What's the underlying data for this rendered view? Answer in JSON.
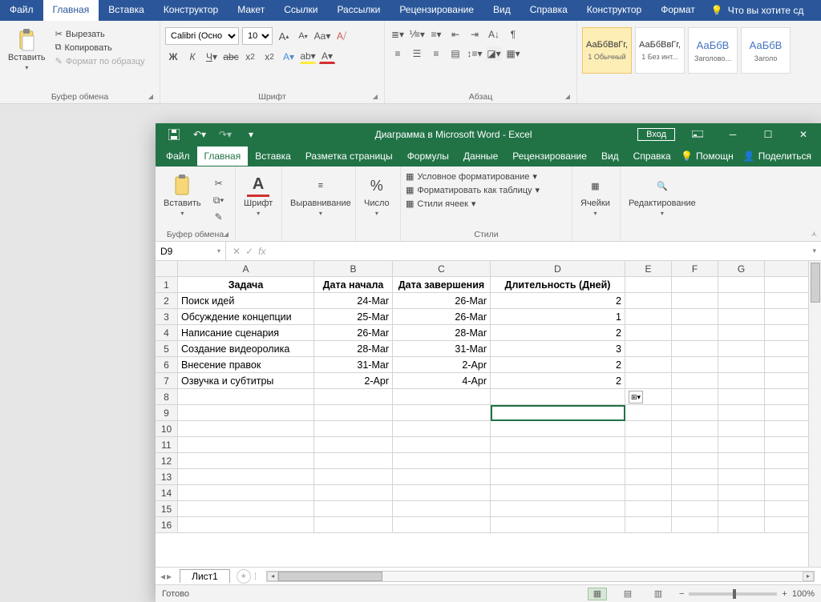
{
  "word": {
    "tabs": [
      "Файл",
      "Главная",
      "Вставка",
      "Конструктор",
      "Макет",
      "Ссылки",
      "Рассылки",
      "Рецензирование",
      "Вид",
      "Справка",
      "Конструктор",
      "Формат"
    ],
    "activeTab": 1,
    "tellMe": "Что вы хотите сд",
    "clipboard": {
      "paste": "Вставить",
      "cut": "Вырезать",
      "copy": "Копировать",
      "format": "Формат по образцу",
      "groupLabel": "Буфер обмена"
    },
    "font": {
      "name": "Calibri (Осно",
      "size": "10",
      "groupLabel": "Шрифт"
    },
    "paragraph": {
      "groupLabel": "Абзац"
    },
    "styles": [
      {
        "preview": "АаБбВвГг,",
        "label": "1 Обычный",
        "sel": true,
        "blue": false
      },
      {
        "preview": "АаБбВвГг,",
        "label": "1 Без инт...",
        "sel": false,
        "blue": false
      },
      {
        "preview": "АаБбВ",
        "label": "Заголово...",
        "sel": false,
        "blue": true
      },
      {
        "preview": "АаБбВ",
        "label": "Заголо",
        "sel": false,
        "blue": true
      }
    ]
  },
  "excel": {
    "title": "Диаграмма в Microsoft Word  -  Excel",
    "login": "Вход",
    "tabs": [
      "Файл",
      "Главная",
      "Вставка",
      "Разметка страницы",
      "Формулы",
      "Данные",
      "Рецензирование",
      "Вид",
      "Справка"
    ],
    "activeTab": 1,
    "help": "Помощн",
    "share": "Поделиться",
    "ribbon": {
      "clipboard": {
        "paste": "Вставить",
        "group": "Буфер обмена"
      },
      "font": {
        "label": "Шрифт"
      },
      "align": {
        "label": "Выравнивание"
      },
      "number": {
        "label": "Число",
        "pct": "%"
      },
      "styles": {
        "cond": "Условное форматирование",
        "table": "Форматировать как таблицу",
        "cell": "Стили ячеек",
        "group": "Стили"
      },
      "cells": {
        "label": "Ячейки"
      },
      "edit": {
        "label": "Редактирование"
      }
    },
    "namebox": "D9",
    "columns": [
      "A",
      "B",
      "C",
      "D",
      "E",
      "F",
      "G"
    ],
    "headerRow": [
      "Задача",
      "Дата начала",
      "Дата завершения",
      "Длительность (Дней)",
      "",
      "",
      ""
    ],
    "rows": [
      [
        "Поиск идей",
        "24-Mar",
        "26-Mar",
        "2",
        "",
        "",
        ""
      ],
      [
        "Обсуждение концепции",
        "25-Mar",
        "26-Mar",
        "1",
        "",
        "",
        ""
      ],
      [
        "Написание сценария",
        "26-Mar",
        "28-Mar",
        "2",
        "",
        "",
        ""
      ],
      [
        "Создание видеоролика",
        "28-Mar",
        "31-Mar",
        "3",
        "",
        "",
        ""
      ],
      [
        "Внесение правок",
        "31-Mar",
        "2-Apr",
        "2",
        "",
        "",
        ""
      ],
      [
        "Озвучка и субтитры",
        "2-Apr",
        "4-Apr",
        "2",
        "",
        "",
        ""
      ]
    ],
    "sheet": "Лист1",
    "status": "Готово",
    "zoom": "100%"
  },
  "chart_data": {
    "type": "table",
    "columns": [
      "Задача",
      "Дата начала",
      "Дата завершения",
      "Длительность (Дней)"
    ],
    "rows": [
      [
        "Поиск идей",
        "24-Mar",
        "26-Mar",
        2
      ],
      [
        "Обсуждение концепции",
        "25-Mar",
        "26-Mar",
        1
      ],
      [
        "Написание сценария",
        "26-Mar",
        "28-Mar",
        2
      ],
      [
        "Создание видеоролика",
        "28-Mar",
        "31-Mar",
        3
      ],
      [
        "Внесение правок",
        "31-Mar",
        "2-Apr",
        2
      ],
      [
        "Озвучка и субтитры",
        "2-Apr",
        "4-Apr",
        2
      ]
    ]
  }
}
